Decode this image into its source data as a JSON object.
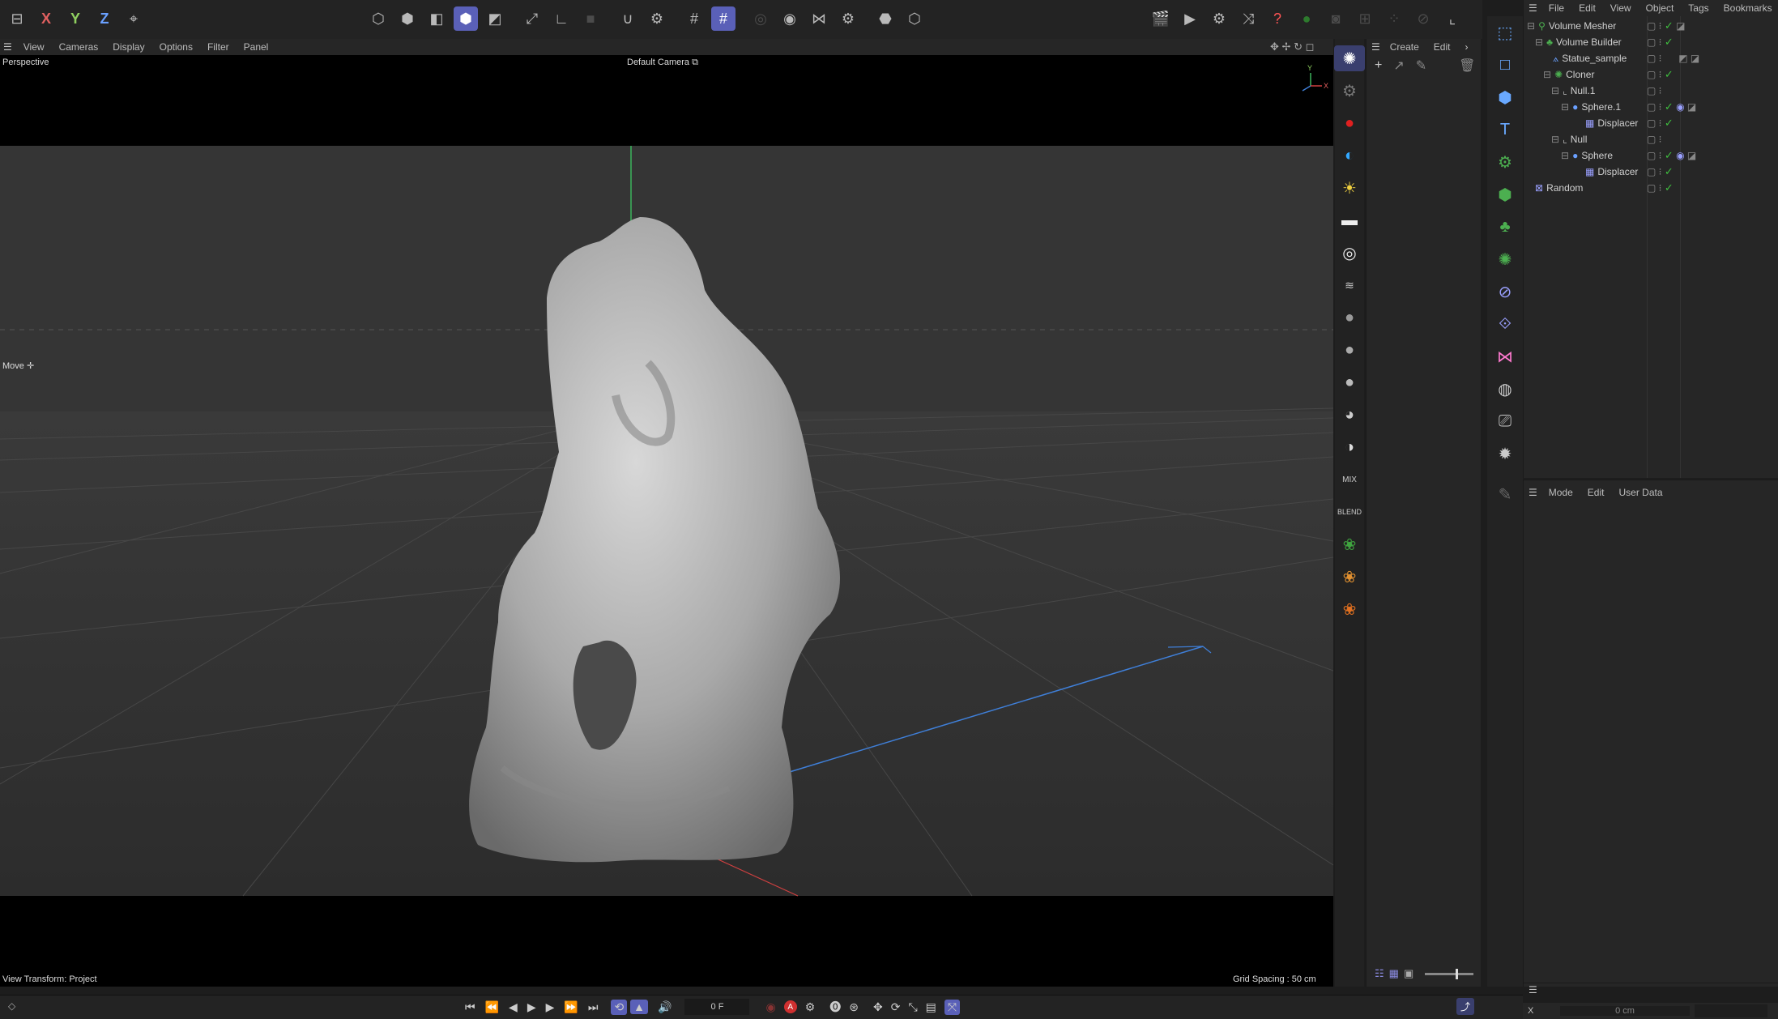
{
  "axes_toolbar": {
    "x": "X",
    "y": "Y",
    "z": "Z"
  },
  "viewport": {
    "menu": [
      "View",
      "Cameras",
      "Display",
      "Options",
      "Filter",
      "Panel"
    ],
    "projection": "Perspective",
    "camera": "Default Camera",
    "tool": "Move",
    "view_transform": "View Transform: Project",
    "grid_spacing": "Grid Spacing : 50 cm"
  },
  "create_panel": {
    "menu": [
      "Create",
      "Edit"
    ]
  },
  "object_manager": {
    "menu": [
      "File",
      "Edit",
      "View",
      "Object",
      "Tags",
      "Bookmarks"
    ],
    "objects": [
      {
        "name": "Volume Mesher",
        "level": 0
      },
      {
        "name": "Volume Builder",
        "level": 1
      },
      {
        "name": "Statue_sample",
        "level": 2
      },
      {
        "name": "Cloner",
        "level": 2
      },
      {
        "name": "Null.1",
        "level": 3
      },
      {
        "name": "Sphere.1",
        "level": 4
      },
      {
        "name": "Displacer",
        "level": 5
      },
      {
        "name": "Null",
        "level": 3
      },
      {
        "name": "Sphere",
        "level": 4
      },
      {
        "name": "Displacer",
        "level": 5
      },
      {
        "name": "Random",
        "level": 0
      }
    ]
  },
  "attribute_manager": {
    "menu": [
      "Mode",
      "Edit",
      "User Data"
    ],
    "coord_label": "X",
    "coord_value": "0 cm"
  },
  "timeline": {
    "frame": "0 F",
    "autokey_label": "A"
  },
  "colors": {
    "accent": "#5a60b8",
    "check": "#3fbf3f",
    "viewport_bg": "#333333"
  }
}
